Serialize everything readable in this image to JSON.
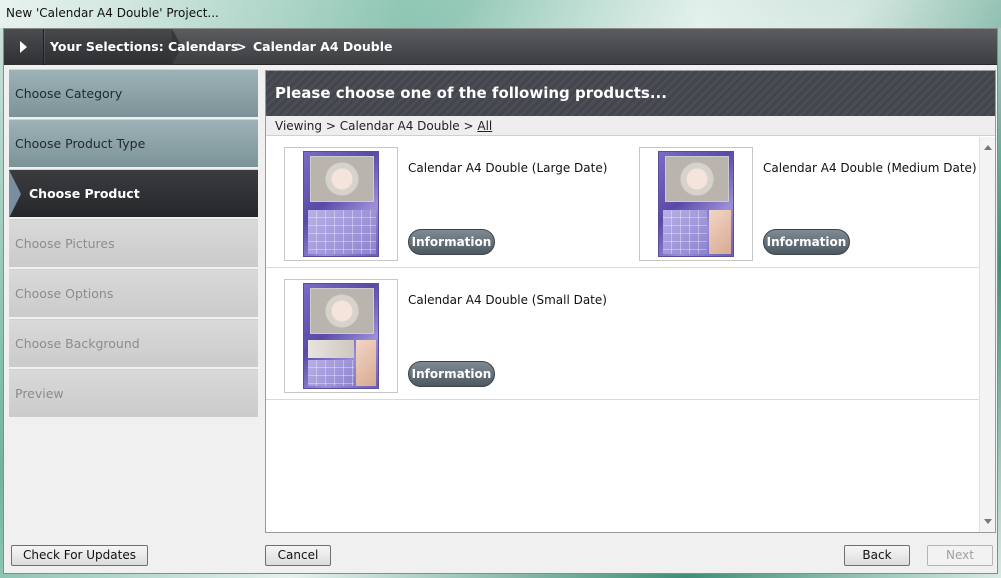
{
  "window": {
    "title": "New 'Calendar A4 Double' Project..."
  },
  "selections": {
    "label": "Your Selections:",
    "crumbs": [
      "Calendars",
      "Calendar A4 Double"
    ],
    "separator": ">"
  },
  "steps": [
    {
      "label": "Choose Category",
      "state": "done"
    },
    {
      "label": "Choose Product Type",
      "state": "done"
    },
    {
      "label": "Choose Product",
      "state": "active"
    },
    {
      "label": "Choose Pictures",
      "state": "todo"
    },
    {
      "label": "Choose Options",
      "state": "todo"
    },
    {
      "label": "Choose Background",
      "state": "todo"
    },
    {
      "label": "Preview",
      "state": "todo"
    }
  ],
  "main": {
    "heading": "Please choose one of the following products...",
    "viewing": {
      "prefix": "Viewing > Calendar A4 Double > ",
      "link": "All"
    },
    "products": [
      {
        "name": "Calendar A4 Double (Large Date)",
        "button": "Information"
      },
      {
        "name": "Calendar A4 Double (Medium Date)",
        "button": "Information"
      },
      {
        "name": "Calendar A4 Double (Small Date)",
        "button": "Information"
      }
    ]
  },
  "footer": {
    "check_updates": "Check For Updates",
    "cancel": "Cancel",
    "back": "Back",
    "next": "Next"
  }
}
